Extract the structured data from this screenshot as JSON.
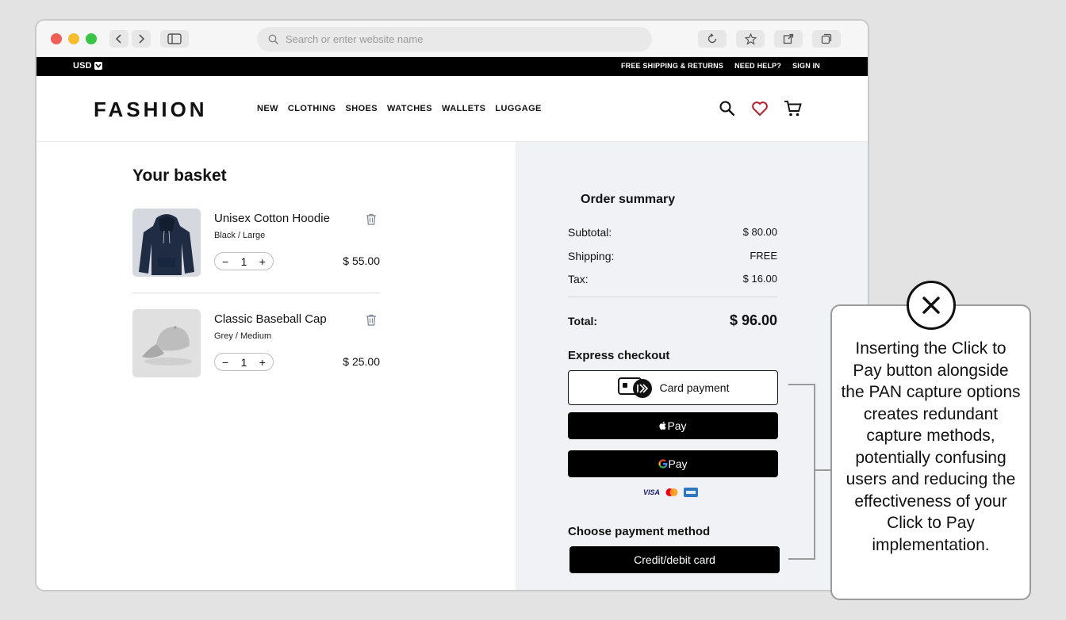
{
  "browser": {
    "url_placeholder": "Search or enter website name"
  },
  "topbar": {
    "currency": "USD",
    "links": [
      "FREE SHIPPING & RETURNS",
      "NEED HELP?",
      "SIGN IN"
    ]
  },
  "nav": {
    "logo": "FASHION",
    "menu": [
      "NEW",
      "CLOTHING",
      "SHOES",
      "WATCHES",
      "WALLETS",
      "LUGGAGE"
    ]
  },
  "basket": {
    "title": "Your basket",
    "items": [
      {
        "name": "Unisex Cotton Hoodie",
        "variant": "Black / Large",
        "qty": "1",
        "price": "$ 55.00"
      },
      {
        "name": "Classic Baseball Cap",
        "variant": "Grey / Medium",
        "qty": "1",
        "price": "$ 25.00"
      }
    ]
  },
  "summary": {
    "title": "Order summary",
    "subtotal_label": "Subtotal:",
    "subtotal": "$ 80.00",
    "shipping_label": "Shipping:",
    "shipping": "FREE",
    "tax_label": "Tax:",
    "tax": "$ 16.00",
    "total_label": "Total:",
    "total": "$ 96.00",
    "express_title": "Express checkout",
    "card_payment_label": "Card payment",
    "apple_pay_label": "Pay",
    "google_pay_label": "Pay",
    "card_brands": [
      "VISA",
      "mastercard",
      "amex"
    ],
    "choose_title": "Choose payment method",
    "credit_label": "Credit/debit card"
  },
  "callout": {
    "text": "Inserting the Click to Pay button alongside the PAN capture options creates redundant capture methods, potentially confusing users and reducing the effectiveness of your Click to Pay implementation."
  },
  "colors": {
    "wishlist_heart": "#b3202b",
    "summary_bg": "#f1f2f6"
  }
}
